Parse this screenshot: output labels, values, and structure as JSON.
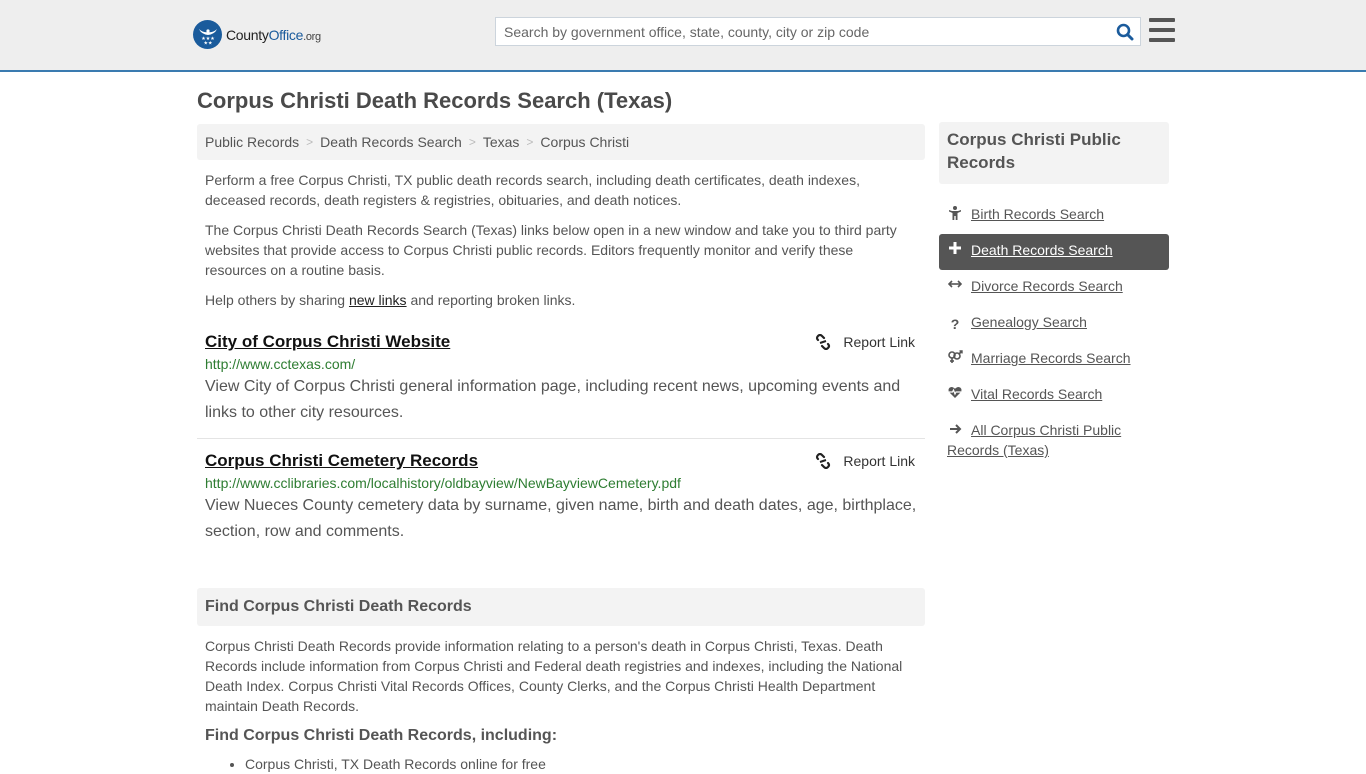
{
  "header": {
    "logo": {
      "name": "County",
      "name_accent": "Office",
      "tld": ".org"
    },
    "search": {
      "placeholder": "Search by government office, state, county, city or zip code",
      "value": ""
    },
    "brand_color": "#1a5b9c",
    "accent_border": "#3a7bb0"
  },
  "page": {
    "title": "Corpus Christi Death Records Search (Texas)"
  },
  "breadcrumb": [
    "Public Records",
    "Death Records Search",
    "Texas",
    "Corpus Christi"
  ],
  "intro": {
    "p1": "Perform a free Corpus Christi, TX public death records search, including death certificates, death indexes, deceased records, death registers & registries, obituaries, and death notices.",
    "p2": "The Corpus Christi Death Records Search (Texas) links below open in a new window and take you to third party websites that provide access to Corpus Christi public records. Editors frequently monitor and verify these resources on a routine basis.",
    "p3_before": "Help others by sharing ",
    "p3_link": "new links",
    "p3_after": " and reporting broken links."
  },
  "links": [
    {
      "title": "City of Corpus Christi Website",
      "url": "http://www.cctexas.com/",
      "description": "View City of Corpus Christi general information page, including recent news, upcoming events and links to other city resources.",
      "report_label": "Report Link"
    },
    {
      "title": "Corpus Christi Cemetery Records",
      "url": "http://www.cclibraries.com/localhistory/oldbayview/NewBayviewCemetery.pdf",
      "description": "View Nueces County cemetery data by surname, given name, birth and death dates, age, birthplace, section, row and comments.",
      "report_label": "Report Link"
    }
  ],
  "find_section": {
    "heading": "Find Corpus Christi Death Records",
    "body": "Corpus Christi Death Records provide information relating to a person's death in Corpus Christi, Texas. Death Records include information from Corpus Christi and Federal death registries and indexes, including the National Death Index. Corpus Christi Vital Records Offices, County Clerks, and the Corpus Christi Health Department maintain Death Records.",
    "subheading": "Find Corpus Christi Death Records, including:",
    "list": [
      "Corpus Christi, TX Death Records online for free"
    ]
  },
  "sidebar": {
    "heading": "Corpus Christi Public Records",
    "items": [
      {
        "label": "Birth Records Search",
        "icon": "child-icon",
        "active": false
      },
      {
        "label": "Death Records Search",
        "icon": "plus-icon",
        "active": true
      },
      {
        "label": "Divorce Records Search",
        "icon": "arrows-horizontal-icon",
        "active": false
      },
      {
        "label": "Genealogy Search",
        "icon": "question-icon",
        "active": false
      },
      {
        "label": "Marriage Records Search",
        "icon": "venus-mars-icon",
        "active": false
      },
      {
        "label": "Vital Records Search",
        "icon": "heartbeat-icon",
        "active": false
      },
      {
        "label": "All Corpus Christi Public Records (Texas)",
        "icon": "arrow-right-icon",
        "active": false
      }
    ]
  }
}
